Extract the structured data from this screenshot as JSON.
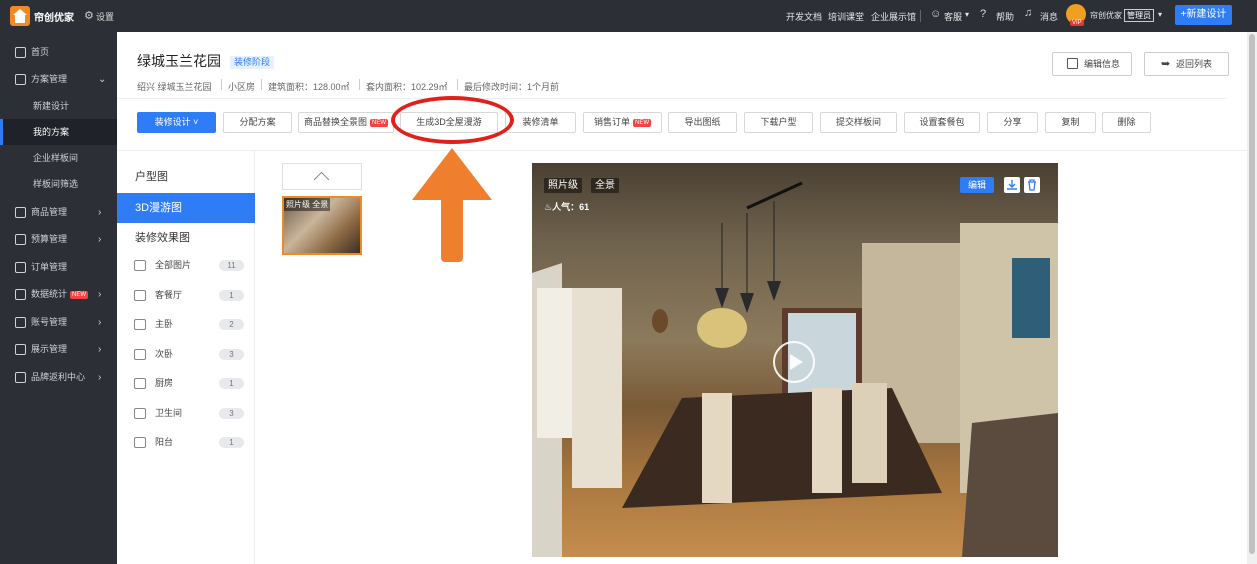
{
  "topbar": {
    "brand": "帘创优家",
    "settings_label": "设置",
    "links": [
      "开发文档",
      "培训课堂",
      "企业展示馆"
    ],
    "service_label": "客服",
    "help_label": "帮助",
    "message_label": "消息",
    "user_name": "帘创优家",
    "user_role": "管理员",
    "vip_badge": "VIP",
    "new_design_label": "+新建设计"
  },
  "sidebar": {
    "items": [
      {
        "label": "首页",
        "icon": "home-icon"
      },
      {
        "label": "方案管理",
        "icon": "scheme-icon",
        "expanded": true
      },
      {
        "label": "新建设计",
        "sub": true
      },
      {
        "label": "我的方案",
        "sub": true,
        "active": true
      },
      {
        "label": "企业样板间",
        "sub": true
      },
      {
        "label": "样板间筛选",
        "sub": true
      },
      {
        "label": "商品管理",
        "icon": "product-icon"
      },
      {
        "label": "预算管理",
        "icon": "budget-icon"
      },
      {
        "label": "订单管理",
        "icon": "order-icon"
      },
      {
        "label": "数据统计",
        "icon": "stats-icon",
        "badge": "NEW"
      },
      {
        "label": "账号管理",
        "icon": "account-icon"
      },
      {
        "label": "展示管理",
        "icon": "display-icon"
      },
      {
        "label": "品牌返利中心",
        "icon": "brand-icon"
      }
    ]
  },
  "project": {
    "title": "绿城玉兰花园",
    "stage": "装修阶段",
    "meta": [
      "绍兴 绿城玉兰花园",
      "小区房",
      "建筑面积：128.00㎡",
      "套内面积：102.29㎡",
      "最后修改时间：1个月前"
    ],
    "edit_info_label": "编辑信息",
    "back_label": "返回列表"
  },
  "toolbar": {
    "buttons": [
      "装修设计 ˅",
      "分配方案",
      "商品替换全景图",
      "生成3D全屋漫游",
      "装修清单",
      "销售订单",
      "导出图纸",
      "下载户型",
      "提交样板间",
      "设置套餐包",
      "分享",
      "复制",
      "删除"
    ],
    "new_badge": "NEW"
  },
  "left_panel": {
    "tabs": [
      "户型图",
      "3D漫游图",
      "装修效果图"
    ],
    "active_tab": "3D漫游图",
    "categories": [
      {
        "label": "全部图片",
        "count": "11",
        "icon": "image-icon"
      },
      {
        "label": "客餐厅",
        "count": "1",
        "icon": "sofa-icon"
      },
      {
        "label": "主卧",
        "count": "2",
        "icon": "bed-icon"
      },
      {
        "label": "次卧",
        "count": "3",
        "icon": "bed-icon"
      },
      {
        "label": "厨房",
        "count": "1",
        "icon": "stove-icon"
      },
      {
        "label": "卫生间",
        "count": "3",
        "icon": "toilet-icon"
      },
      {
        "label": "阳台",
        "count": "1",
        "icon": "balcony-icon"
      }
    ]
  },
  "thumbnail": {
    "caption_quality": "照片级",
    "caption_type": "全景"
  },
  "viewer": {
    "tag_quality": "照片级",
    "tag_type": "全景",
    "popularity": "人气：61",
    "edit_label": "编辑"
  },
  "colors": {
    "topbar_bg": "#2c2f36",
    "accent": "#2f7df6",
    "annotation_red": "#e0211b",
    "annotation_orange": "#f07f2d"
  }
}
